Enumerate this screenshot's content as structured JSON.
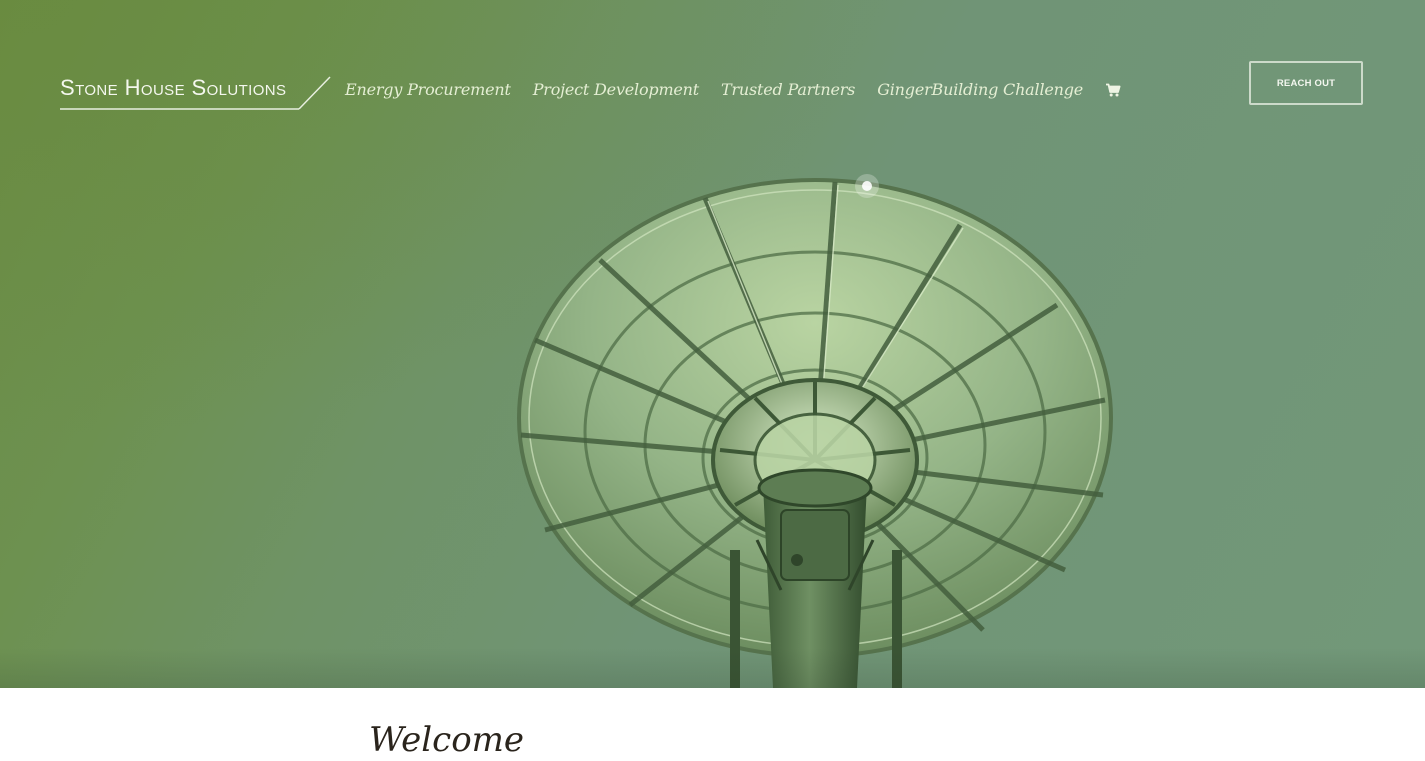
{
  "site": {
    "brand": "Stone House Solutions"
  },
  "nav": {
    "items": [
      {
        "label": "Energy Procurement"
      },
      {
        "label": "Project Development"
      },
      {
        "label": "Trusted Partners"
      },
      {
        "label": "GingerBuilding Challenge"
      }
    ],
    "cart_icon": "shopping-cart-icon"
  },
  "header": {
    "cta_label": "REACH OUT"
  },
  "hero": {
    "image": "satellite-dish-photo",
    "tint_color": "#6f9366"
  },
  "main": {
    "heading": "Welcome"
  },
  "colors": {
    "hero_green": "#6b8c45",
    "hero_sage": "#729879",
    "nav_text": "#e4eed3",
    "heading_text": "#2a241c"
  }
}
